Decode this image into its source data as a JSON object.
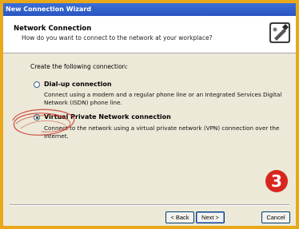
{
  "window": {
    "title": "New Connection Wizard"
  },
  "header": {
    "title": "Network Connection",
    "subtitle": "How do you want to connect to the network at your workplace?",
    "icon": "network-wizard-icon"
  },
  "content": {
    "prompt": "Create the following connection:",
    "options": [
      {
        "label": "Dial-up connection",
        "description": "Connect using a modem and a regular phone line or an Integrated Services Digital Network (ISDN) phone line.",
        "selected": false
      },
      {
        "label": "Virtual Private Network connection",
        "description": "Connect to the network using a virtual private network (VPN) connection over the Internet.",
        "selected": true
      }
    ]
  },
  "annotation": {
    "step_number": "3",
    "color": "#d8261f"
  },
  "buttons": {
    "back": "< Back",
    "next": "Next >",
    "cancel": "Cancel"
  },
  "colors": {
    "background": "#e9a81a",
    "titlebar": "#2a55c0",
    "dialog": "#ece9d8"
  }
}
